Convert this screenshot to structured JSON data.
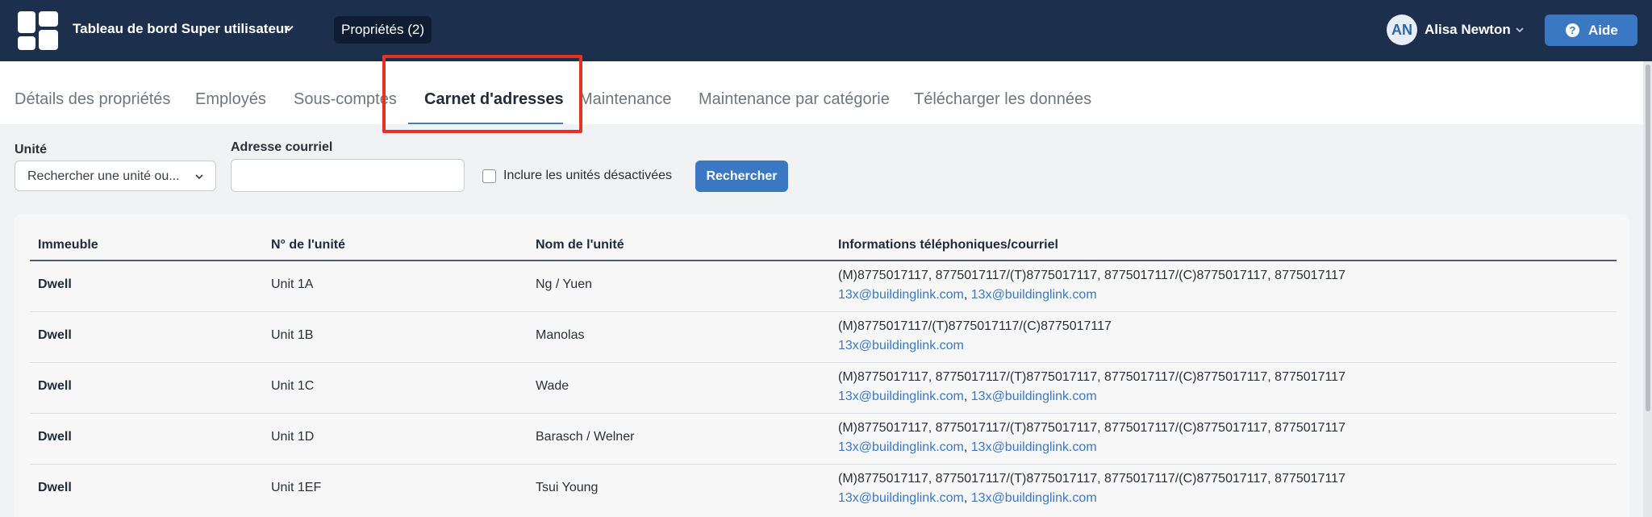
{
  "header": {
    "dashboard_title": "Tableau de bord Super utilisateur",
    "properties_pill": "Propriétés (2)",
    "user_initials": "AN",
    "user_name": "Alisa Newton",
    "help_label": "Aide",
    "help_icon": "?"
  },
  "tabs": [
    {
      "label": "Détails des propriétés",
      "active": false
    },
    {
      "label": "Employés",
      "active": false
    },
    {
      "label": "Sous-comptes",
      "active": false
    },
    {
      "label": "Carnet d'adresses",
      "active": true
    },
    {
      "label": "Maintenance",
      "active": false
    },
    {
      "label": "Maintenance par catégorie",
      "active": false
    },
    {
      "label": "Télécharger les données",
      "active": false
    }
  ],
  "filters": {
    "unit_label": "Unité",
    "unit_placeholder": "Rechercher une unité ou...",
    "email_label": "Adresse courriel",
    "email_value": "",
    "include_disabled_label": "Inclure les unités désactivées",
    "include_disabled_checked": false,
    "search_button": "Rechercher"
  },
  "table": {
    "columns": [
      "Immeuble",
      "N° de l'unité",
      "Nom de l'unité",
      "Informations téléphoniques/courriel"
    ],
    "rows": [
      {
        "building": "Dwell",
        "unit_number": "Unit 1A",
        "unit_name": "Ng / Yuen",
        "phones": "(M)8775017117, 8775017117/(T)8775017117, 8775017117/(C)8775017117, 8775017117",
        "email1": "13x@buildinglink.com",
        "sep": ", ",
        "email2": "13x@buildinglink.com"
      },
      {
        "building": "Dwell",
        "unit_number": "Unit 1B",
        "unit_name": "Manolas",
        "phones": "(M)8775017117/(T)8775017117/(C)8775017117",
        "email1": "13x@buildinglink.com",
        "sep": "",
        "email2": ""
      },
      {
        "building": "Dwell",
        "unit_number": "Unit 1C",
        "unit_name": "Wade",
        "phones": "(M)8775017117, 8775017117/(T)8775017117, 8775017117/(C)8775017117, 8775017117",
        "email1": "13x@buildinglink.com",
        "sep": ", ",
        "email2": "13x@buildinglink.com"
      },
      {
        "building": "Dwell",
        "unit_number": "Unit 1D",
        "unit_name": "Barasch / Welner",
        "phones": "(M)8775017117, 8775017117/(T)8775017117, 8775017117/(C)8775017117, 8775017117",
        "email1": "13x@buildinglink.com",
        "sep": ", ",
        "email2": "13x@buildinglink.com"
      },
      {
        "building": "Dwell",
        "unit_number": "Unit 1EF",
        "unit_name": "Tsui Young",
        "phones": "(M)8775017117, 8775017117/(T)8775017117, 8775017117/(C)8775017117, 8775017117",
        "email1": "13x@buildinglink.com",
        "sep": ", ",
        "email2": "13x@buildinglink.com"
      }
    ]
  },
  "colors": {
    "topbar": "#1c2f4d",
    "accent": "#3a78c4",
    "highlight": "#e53224"
  },
  "icons": {
    "logo": "grid-logo-icon",
    "dashboard_dropdown": "chevron-down-icon",
    "user_dropdown": "chevron-down-icon",
    "help": "question-circle-icon",
    "unit_select": "chevron-down-icon"
  }
}
